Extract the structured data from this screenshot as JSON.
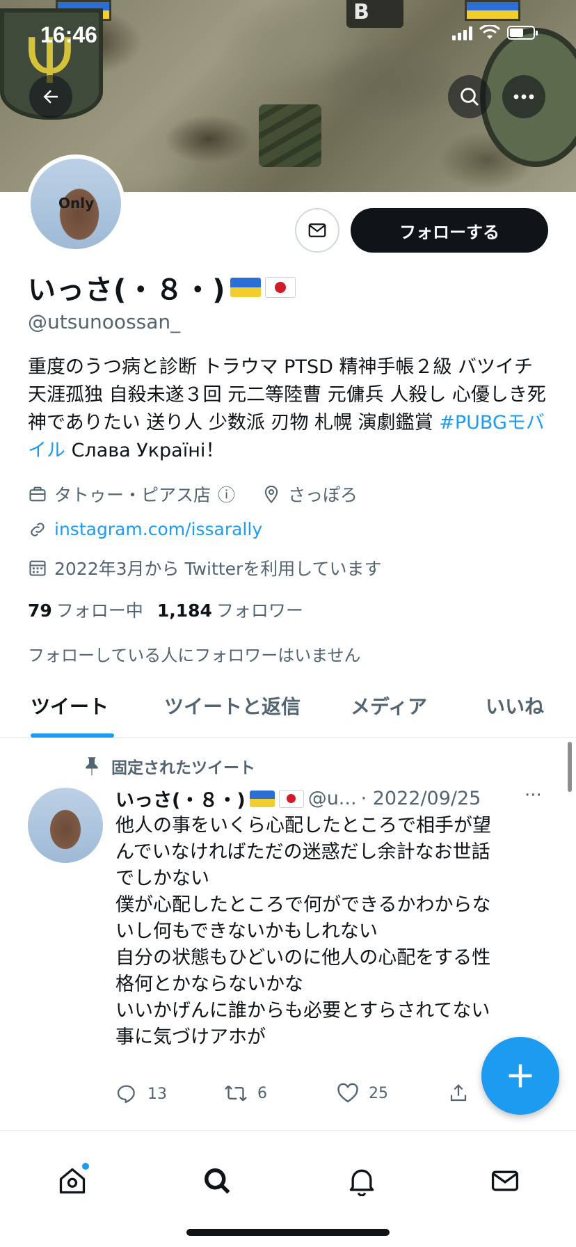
{
  "status_bar": {
    "time": "16:46"
  },
  "header": {
    "nav_back": "back",
    "nav_search": "search",
    "nav_more": "more"
  },
  "profile": {
    "display_name": "いっさ(・８・)",
    "handle": "@utsunoossan_",
    "follow_label": "フォローする",
    "bio_text": "重度のうつ病と診断 トラウマ PTSD 精神手帳２級 バツイチ 天涯孤独 自殺未遂３回 元二等陸曹 元傭兵 人殺し 心優しき死神でありたい 送り人 少数派 刃物 札幌 演劇鑑賞 ",
    "bio_hashtag": "#PUBGモバイル",
    "bio_tail": " Слава Україні！",
    "work": "タトゥー・ピアス店",
    "work_info": "ⓘ",
    "location": "さっぽろ",
    "link": "instagram.com/issarally",
    "joined": "2022年3月から Twitterを利用しています",
    "following_count": "79",
    "following_label": "フォロー中",
    "followers_count": "1,184",
    "followers_label": "フォロワー",
    "no_mutual": "フォローしている人にフォロワーはいません",
    "avatar_text": "Only"
  },
  "tabs": [
    {
      "label": "ツイート"
    },
    {
      "label": "ツイートと返信"
    },
    {
      "label": "メディア"
    },
    {
      "label": "いいね"
    }
  ],
  "pinned_tweet": {
    "pin_label": "固定されたツイート",
    "author_name": "いっさ(・８・)",
    "author_handle_trunc": "@u...",
    "date": "· 2022/09/25",
    "more": "···",
    "lines": [
      "他人の事をいくら心配したところで相手が望",
      "んでいなければただの迷惑だし余計なお世話",
      "でしかない",
      "僕が心配したところで何ができるかわからな",
      "いし何もできないかもしれない",
      "自分の状態もひどいのに他人の心配をする性",
      "格何とかならないかな",
      "いいかげんに誰からも必要とすらされてない",
      "事に気づけアホが"
    ],
    "replies": "13",
    "retweets": "6",
    "likes": "25"
  },
  "colors": {
    "accent": "#1d9bf0",
    "text": "#0f1419",
    "secondary": "#536471"
  },
  "icons": [
    "back-icon",
    "search-icon",
    "more-icon",
    "mail-icon",
    "briefcase-icon",
    "location-icon",
    "link-icon",
    "calendar-icon",
    "pin-icon",
    "reply-icon",
    "retweet-icon",
    "like-icon",
    "share-icon",
    "plus-icon",
    "home-icon",
    "search-nav-icon",
    "bell-icon",
    "messages-icon"
  ]
}
